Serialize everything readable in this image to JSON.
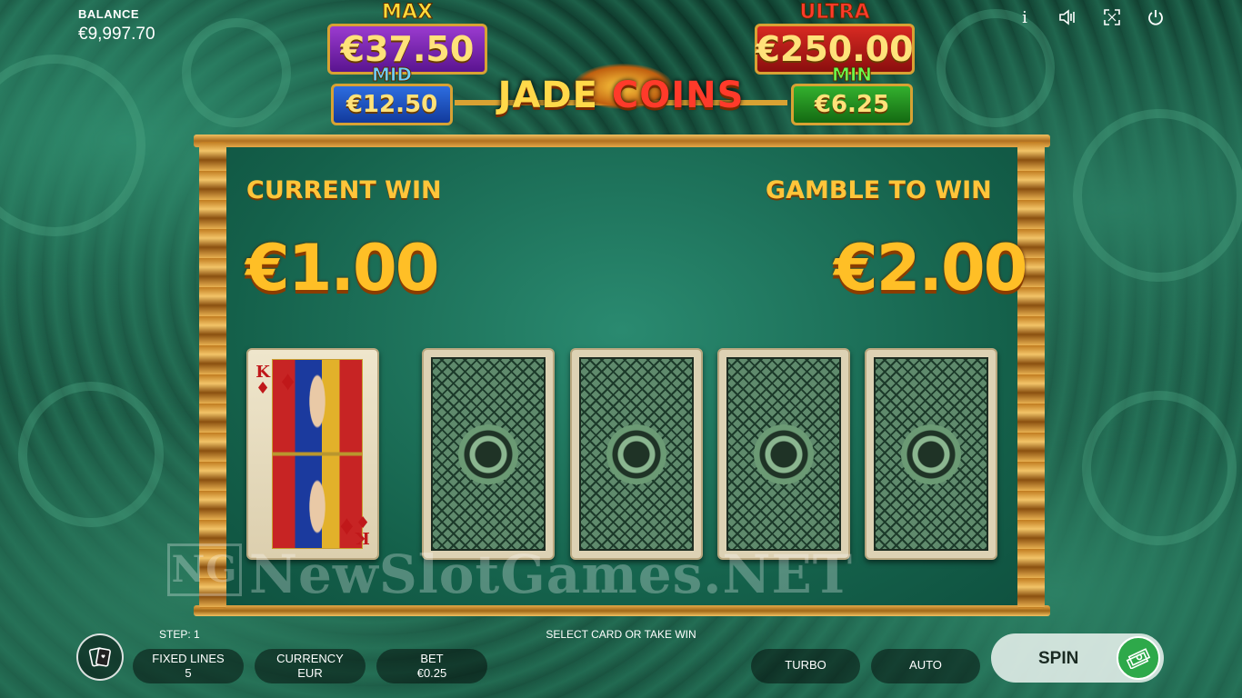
{
  "balance": {
    "label": "BALANCE",
    "value": "€9,997.70"
  },
  "top_icons": [
    "info-icon",
    "sound-icon",
    "fullscreen-icon",
    "power-icon"
  ],
  "jackpots": {
    "max": {
      "label": "MAX",
      "value": "€37.50",
      "color": "#6a1fa8"
    },
    "mid": {
      "label": "MID",
      "value": "€12.50",
      "color": "#1f52c4"
    },
    "ultra": {
      "label": "ULTRA",
      "value": "€250.00",
      "color": "#b01818"
    },
    "min": {
      "label": "MIN",
      "value": "€6.25",
      "color": "#1f8a1c"
    }
  },
  "logo": {
    "part1": "JADE",
    "part2": "COINS"
  },
  "gamble": {
    "current_win_label": "CURRENT WIN",
    "current_win_value": "€1.00",
    "gamble_label": "GAMBLE TO WIN",
    "gamble_value": "€2.00",
    "revealed_card": {
      "rank": "K",
      "suit": "♦"
    }
  },
  "watermark": {
    "mark": "NG",
    "text": "NewSlotGames.NET"
  },
  "bottom": {
    "step": "STEP: 1",
    "message": "SELECT CARD OR TAKE WIN",
    "fixed_lines_label": "FIXED LINES",
    "fixed_lines_value": "5",
    "currency_label": "CURRENCY",
    "currency_value": "EUR",
    "bet_label": "BET",
    "bet_value": "€0.25",
    "turbo": "TURBO",
    "auto": "AUTO",
    "spin": "SPIN"
  }
}
